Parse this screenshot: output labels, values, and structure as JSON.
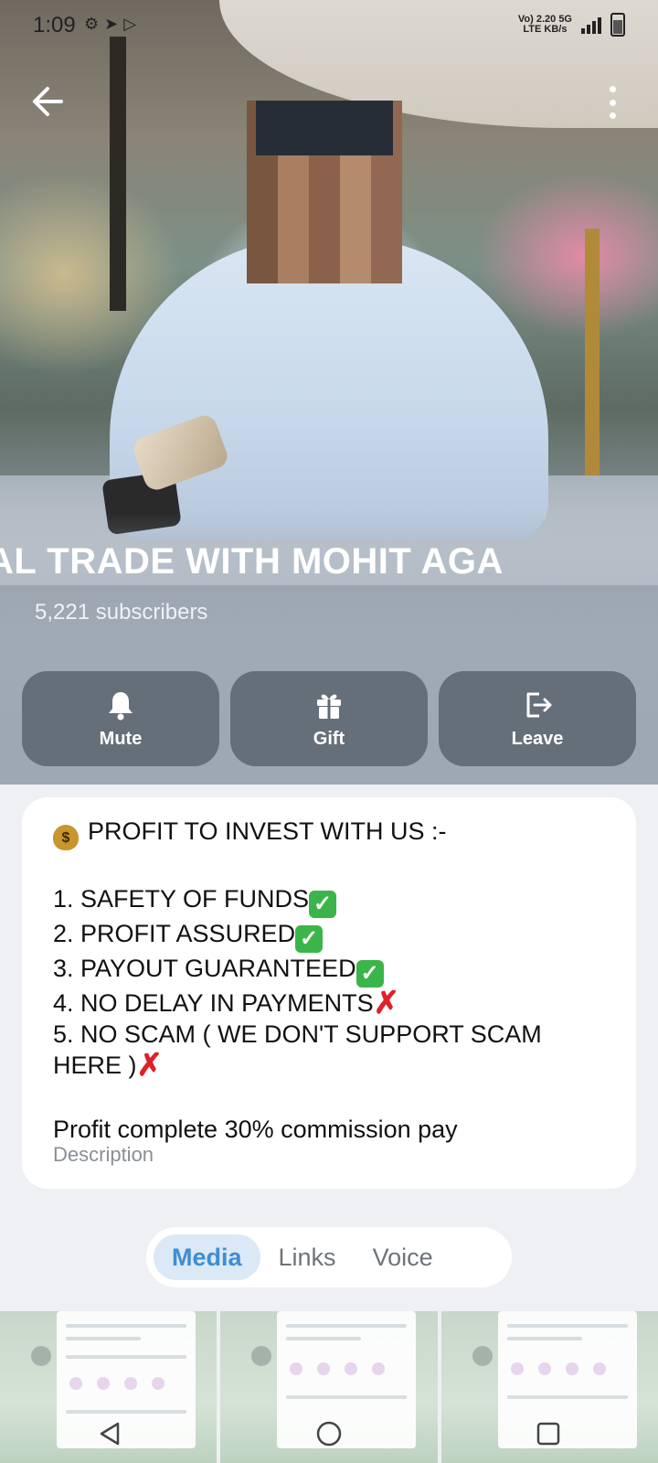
{
  "status_bar": {
    "time": "1:09",
    "network_top": "Vo) 2.20 5G",
    "network_lte": "LTE",
    "network_speed_unit": "KB/s"
  },
  "header": {
    "channel_title": "WAL    TRADE WITH MOHIT AGA",
    "subscribers": "5,221 subscribers"
  },
  "actions": [
    {
      "label": "Mute",
      "icon": "bell-icon"
    },
    {
      "label": "Gift",
      "icon": "gift-icon"
    },
    {
      "label": "Leave",
      "icon": "leave-icon"
    }
  ],
  "about": {
    "headline": "PROFIT TO INVEST WITH US :-",
    "items": [
      {
        "text": "1. SAFETY OF FUNDS",
        "mark": "check"
      },
      {
        "text": "2. PROFIT ASSURED",
        "mark": "check"
      },
      {
        "text": "3. PAYOUT GUARANTEED",
        "mark": "check"
      },
      {
        "text": "4. NO DELAY IN PAYMENTS",
        "mark": "cross"
      }
    ],
    "item5_line1": "5. NO SCAM ( WE DON'T SUPPORT SCAM",
    "item5_line2": "HERE )",
    "profit_line": "Profit complete 30% commission pay",
    "description_label": "Description"
  },
  "tabs": [
    {
      "label": "Media",
      "active": true
    },
    {
      "label": "Links",
      "active": false
    },
    {
      "label": "Voice",
      "active": false
    }
  ],
  "colors": {
    "accent": "#3d8dd6",
    "check": "#3bb54a",
    "cross": "#e0202b"
  }
}
